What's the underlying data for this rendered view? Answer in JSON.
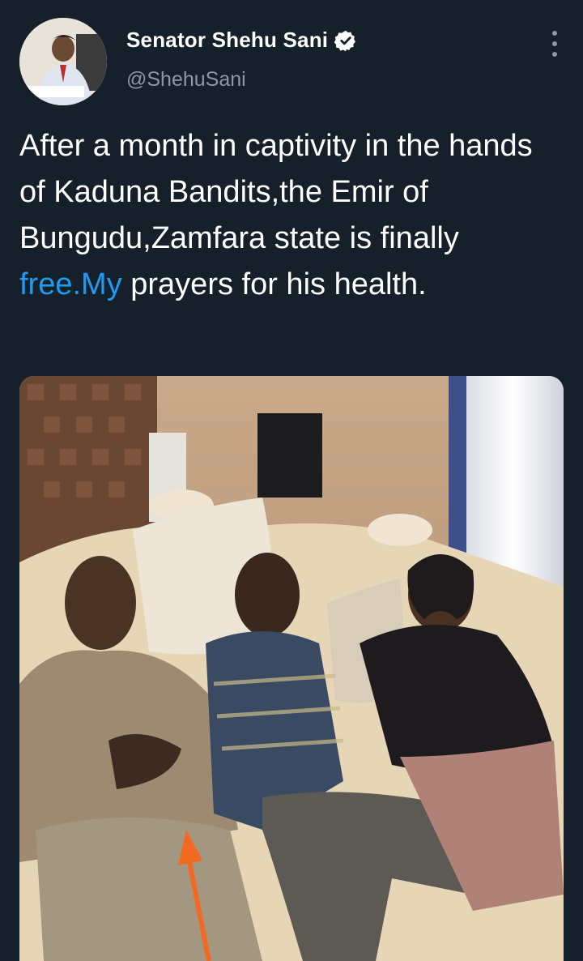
{
  "author": {
    "name": "Senator Shehu Sani",
    "handle": "@ShehuSani",
    "verified": true
  },
  "tweet": {
    "text_before": "After a month in captivity in the hands of Kaduna Bandits,the Emir of Bungudu,Zamfara state is finally ",
    "link_text": "free.My",
    "text_after": " prayers for his health."
  },
  "colors": {
    "background": "#15202b",
    "text": "#ffffff",
    "secondary": "#8b98a5",
    "link": "#1d9bf0",
    "arrow": "#f26a21"
  },
  "icons": [
    "verified-badge-icon",
    "more-options-icon"
  ]
}
